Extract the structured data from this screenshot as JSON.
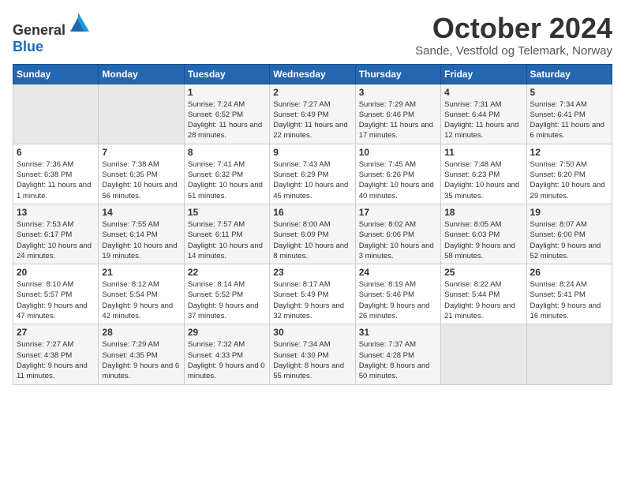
{
  "header": {
    "logo_general": "General",
    "logo_blue": "Blue",
    "month": "October 2024",
    "location": "Sande, Vestfold og Telemark, Norway"
  },
  "weekdays": [
    "Sunday",
    "Monday",
    "Tuesday",
    "Wednesday",
    "Thursday",
    "Friday",
    "Saturday"
  ],
  "weeks": [
    [
      {
        "day": "",
        "sunrise": "",
        "sunset": "",
        "daylight": ""
      },
      {
        "day": "",
        "sunrise": "",
        "sunset": "",
        "daylight": ""
      },
      {
        "day": "1",
        "sunrise": "Sunrise: 7:24 AM",
        "sunset": "Sunset: 6:52 PM",
        "daylight": "Daylight: 11 hours and 28 minutes."
      },
      {
        "day": "2",
        "sunrise": "Sunrise: 7:27 AM",
        "sunset": "Sunset: 6:49 PM",
        "daylight": "Daylight: 11 hours and 22 minutes."
      },
      {
        "day": "3",
        "sunrise": "Sunrise: 7:29 AM",
        "sunset": "Sunset: 6:46 PM",
        "daylight": "Daylight: 11 hours and 17 minutes."
      },
      {
        "day": "4",
        "sunrise": "Sunrise: 7:31 AM",
        "sunset": "Sunset: 6:44 PM",
        "daylight": "Daylight: 11 hours and 12 minutes."
      },
      {
        "day": "5",
        "sunrise": "Sunrise: 7:34 AM",
        "sunset": "Sunset: 6:41 PM",
        "daylight": "Daylight: 11 hours and 6 minutes."
      }
    ],
    [
      {
        "day": "6",
        "sunrise": "Sunrise: 7:36 AM",
        "sunset": "Sunset: 6:38 PM",
        "daylight": "Daylight: 11 hours and 1 minute."
      },
      {
        "day": "7",
        "sunrise": "Sunrise: 7:38 AM",
        "sunset": "Sunset: 6:35 PM",
        "daylight": "Daylight: 10 hours and 56 minutes."
      },
      {
        "day": "8",
        "sunrise": "Sunrise: 7:41 AM",
        "sunset": "Sunset: 6:32 PM",
        "daylight": "Daylight: 10 hours and 51 minutes."
      },
      {
        "day": "9",
        "sunrise": "Sunrise: 7:43 AM",
        "sunset": "Sunset: 6:29 PM",
        "daylight": "Daylight: 10 hours and 45 minutes."
      },
      {
        "day": "10",
        "sunrise": "Sunrise: 7:45 AM",
        "sunset": "Sunset: 6:26 PM",
        "daylight": "Daylight: 10 hours and 40 minutes."
      },
      {
        "day": "11",
        "sunrise": "Sunrise: 7:48 AM",
        "sunset": "Sunset: 6:23 PM",
        "daylight": "Daylight: 10 hours and 35 minutes."
      },
      {
        "day": "12",
        "sunrise": "Sunrise: 7:50 AM",
        "sunset": "Sunset: 6:20 PM",
        "daylight": "Daylight: 10 hours and 29 minutes."
      }
    ],
    [
      {
        "day": "13",
        "sunrise": "Sunrise: 7:53 AM",
        "sunset": "Sunset: 6:17 PM",
        "daylight": "Daylight: 10 hours and 24 minutes."
      },
      {
        "day": "14",
        "sunrise": "Sunrise: 7:55 AM",
        "sunset": "Sunset: 6:14 PM",
        "daylight": "Daylight: 10 hours and 19 minutes."
      },
      {
        "day": "15",
        "sunrise": "Sunrise: 7:57 AM",
        "sunset": "Sunset: 6:11 PM",
        "daylight": "Daylight: 10 hours and 14 minutes."
      },
      {
        "day": "16",
        "sunrise": "Sunrise: 8:00 AM",
        "sunset": "Sunset: 6:09 PM",
        "daylight": "Daylight: 10 hours and 8 minutes."
      },
      {
        "day": "17",
        "sunrise": "Sunrise: 8:02 AM",
        "sunset": "Sunset: 6:06 PM",
        "daylight": "Daylight: 10 hours and 3 minutes."
      },
      {
        "day": "18",
        "sunrise": "Sunrise: 8:05 AM",
        "sunset": "Sunset: 6:03 PM",
        "daylight": "Daylight: 9 hours and 58 minutes."
      },
      {
        "day": "19",
        "sunrise": "Sunrise: 8:07 AM",
        "sunset": "Sunset: 6:00 PM",
        "daylight": "Daylight: 9 hours and 52 minutes."
      }
    ],
    [
      {
        "day": "20",
        "sunrise": "Sunrise: 8:10 AM",
        "sunset": "Sunset: 5:57 PM",
        "daylight": "Daylight: 9 hours and 47 minutes."
      },
      {
        "day": "21",
        "sunrise": "Sunrise: 8:12 AM",
        "sunset": "Sunset: 5:54 PM",
        "daylight": "Daylight: 9 hours and 42 minutes."
      },
      {
        "day": "22",
        "sunrise": "Sunrise: 8:14 AM",
        "sunset": "Sunset: 5:52 PM",
        "daylight": "Daylight: 9 hours and 37 minutes."
      },
      {
        "day": "23",
        "sunrise": "Sunrise: 8:17 AM",
        "sunset": "Sunset: 5:49 PM",
        "daylight": "Daylight: 9 hours and 32 minutes."
      },
      {
        "day": "24",
        "sunrise": "Sunrise: 8:19 AM",
        "sunset": "Sunset: 5:46 PM",
        "daylight": "Daylight: 9 hours and 26 minutes."
      },
      {
        "day": "25",
        "sunrise": "Sunrise: 8:22 AM",
        "sunset": "Sunset: 5:44 PM",
        "daylight": "Daylight: 9 hours and 21 minutes."
      },
      {
        "day": "26",
        "sunrise": "Sunrise: 8:24 AM",
        "sunset": "Sunset: 5:41 PM",
        "daylight": "Daylight: 9 hours and 16 minutes."
      }
    ],
    [
      {
        "day": "27",
        "sunrise": "Sunrise: 7:27 AM",
        "sunset": "Sunset: 4:38 PM",
        "daylight": "Daylight: 9 hours and 11 minutes."
      },
      {
        "day": "28",
        "sunrise": "Sunrise: 7:29 AM",
        "sunset": "Sunset: 4:35 PM",
        "daylight": "Daylight: 9 hours and 6 minutes."
      },
      {
        "day": "29",
        "sunrise": "Sunrise: 7:32 AM",
        "sunset": "Sunset: 4:33 PM",
        "daylight": "Daylight: 9 hours and 0 minutes."
      },
      {
        "day": "30",
        "sunrise": "Sunrise: 7:34 AM",
        "sunset": "Sunset: 4:30 PM",
        "daylight": "Daylight: 8 hours and 55 minutes."
      },
      {
        "day": "31",
        "sunrise": "Sunrise: 7:37 AM",
        "sunset": "Sunset: 4:28 PM",
        "daylight": "Daylight: 8 hours and 50 minutes."
      },
      {
        "day": "",
        "sunrise": "",
        "sunset": "",
        "daylight": ""
      },
      {
        "day": "",
        "sunrise": "",
        "sunset": "",
        "daylight": ""
      }
    ]
  ]
}
